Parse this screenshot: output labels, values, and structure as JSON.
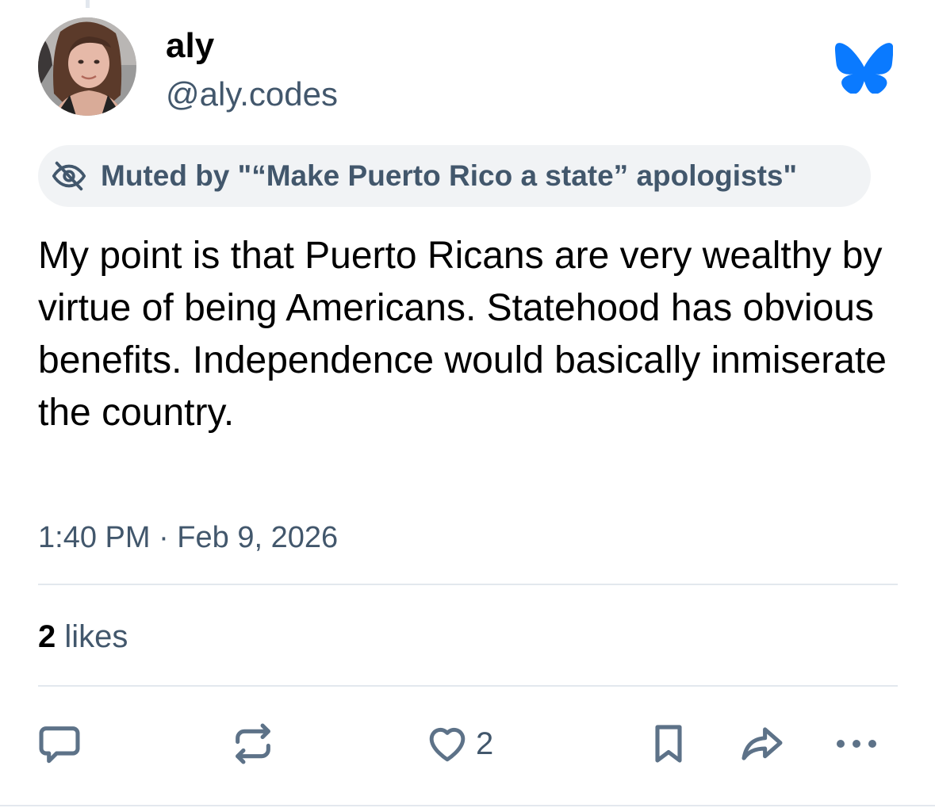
{
  "post": {
    "author_name": "aly",
    "author_handle": "@aly.codes",
    "muted_notice": "Muted by \"“Make Puerto Rico a state” apologists\"",
    "text": "My point is that Puerto Ricans are very wealthy by virtue of being Americans. Statehood has obvious benefits. Independence would basically inmiserate the country.",
    "timestamp": "1:40 PM · Feb 9, 2026",
    "likes_count": "2",
    "likes_label": " likes"
  },
  "actions": {
    "like_count": "2"
  },
  "icons": {
    "reply": "reply-icon",
    "repost": "repost-icon",
    "like": "heart-icon",
    "bookmark": "bookmark-icon",
    "share": "share-icon",
    "more": "more-icon",
    "mute": "eye-slash-icon",
    "brand": "bluesky-butterfly-icon"
  },
  "colors": {
    "brand_blue": "#0a7aff",
    "secondary_text": "#42576c",
    "pill_background": "#f1f3f5",
    "divider": "#e3e8ee"
  }
}
